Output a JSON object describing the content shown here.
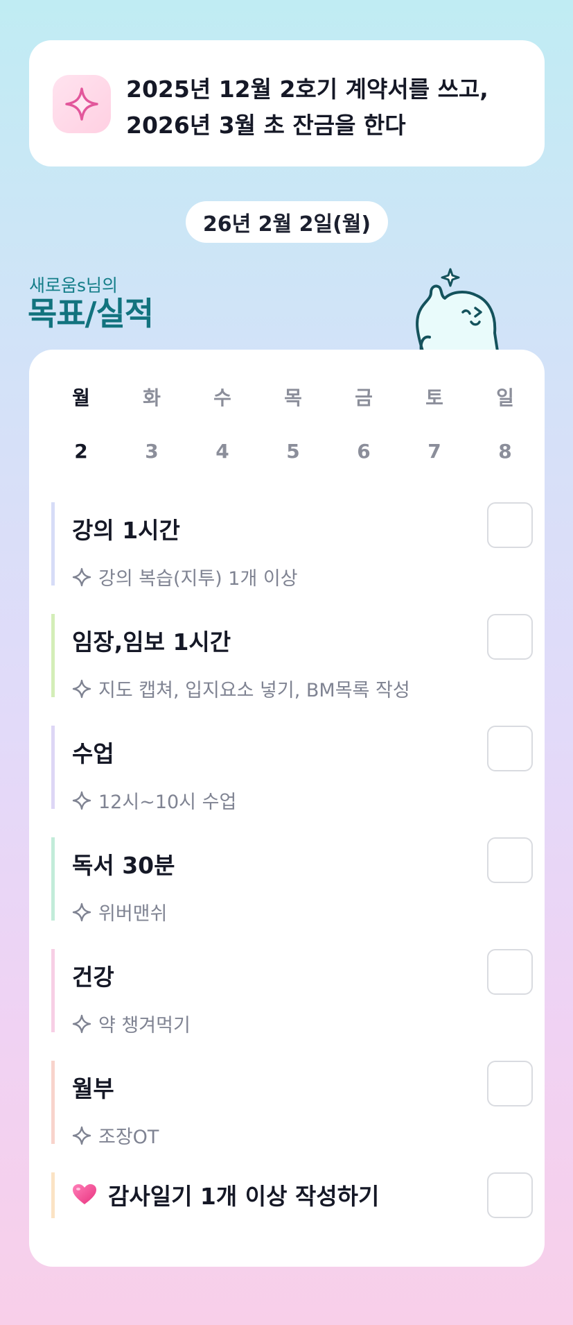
{
  "goal": {
    "icon": "sparkle-icon",
    "line1": "2025년 12월 2호기 계약서를 쓰고,",
    "line2": "2026년 3월 초 잔금을 한다"
  },
  "date_label": "26년 2월 2일(월)",
  "owner": {
    "name_label": "새로움s님의",
    "title": "목표/실적"
  },
  "week": {
    "days": [
      "월",
      "화",
      "수",
      "목",
      "금",
      "토",
      "일"
    ],
    "dates": [
      "2",
      "3",
      "4",
      "5",
      "6",
      "7",
      "8"
    ],
    "selected_index": 0
  },
  "tasks": [
    {
      "title": "강의 1시간",
      "sub": "강의 복습(지투) 1개 이상",
      "bar_color": "#d6dcf7",
      "checked": false
    },
    {
      "title": "임장,임보 1시간",
      "sub": "지도 캡쳐, 입지요소 넣기, BM목록 작성",
      "bar_color": "#d4eeb8",
      "checked": false
    },
    {
      "title": "수업",
      "sub": "12시~10시 수업",
      "bar_color": "#ddd6f5",
      "checked": false
    },
    {
      "title": "독서 30분",
      "sub": "위버맨쉬",
      "bar_color": "#c2ecd9",
      "checked": false
    },
    {
      "title": "건강",
      "sub": "약 챙겨먹기",
      "bar_color": "#f7cfe5",
      "checked": false
    },
    {
      "title": "월부",
      "sub": "조장OT",
      "bar_color": "#f8d4cc",
      "checked": false
    }
  ],
  "gratitude": {
    "icon": "heart-icon",
    "title": "감사일기 1개 이상 작성하기",
    "bar_color": "#fbe3c4",
    "checked": false
  },
  "colors": {
    "accent_teal": "#12737e",
    "sparkle_pink": "#e2579b",
    "heart_pink": "#f0468f"
  }
}
